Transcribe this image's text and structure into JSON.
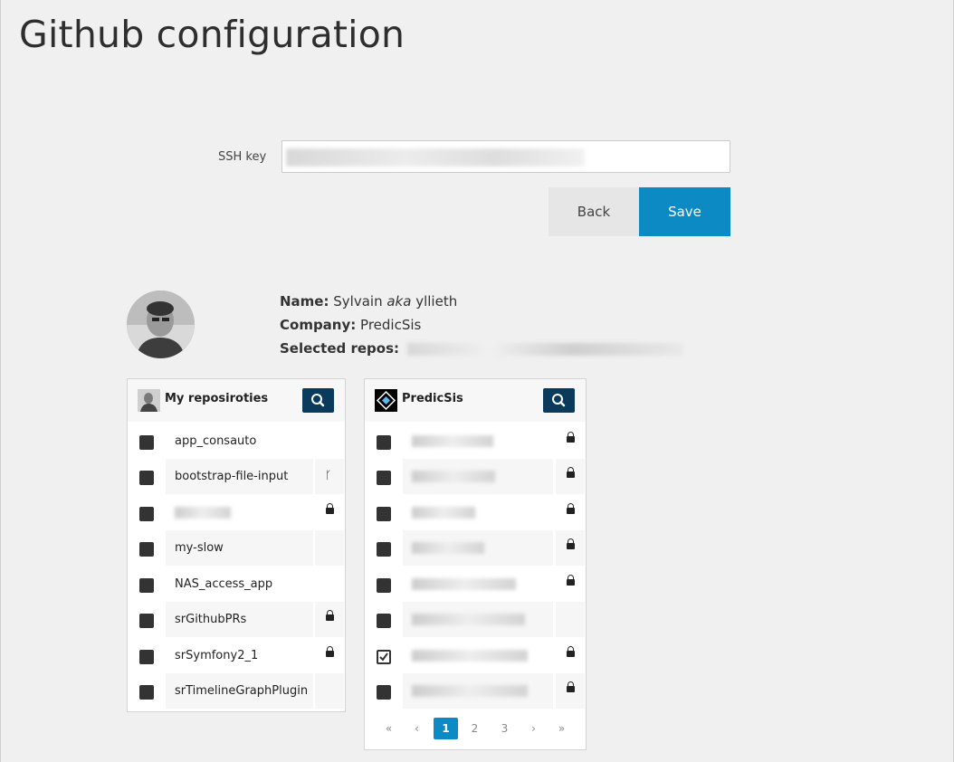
{
  "page": {
    "title": "Github configuration"
  },
  "form": {
    "ssh_label": "SSH key",
    "back_label": "Back",
    "save_label": "Save"
  },
  "profile": {
    "name_label": "Name:",
    "name_first": "Sylvain",
    "aka": "aka",
    "username": "yllieth",
    "company_label": "Company:",
    "company": "PredicSis",
    "repos_label": "Selected repos:"
  },
  "left_panel": {
    "title": "My reposiroties",
    "rows": [
      {
        "name": "app_consauto",
        "icon": ""
      },
      {
        "name": "bootstrap-file-input",
        "icon": "fork-icon"
      },
      {
        "name": "",
        "icon": "lock-icon"
      },
      {
        "name": "my-slow",
        "icon": ""
      },
      {
        "name": "NAS_access_app",
        "icon": ""
      },
      {
        "name": "srGithubPRs",
        "icon": "lock-icon"
      },
      {
        "name": "srSymfony2_1",
        "icon": "lock-icon"
      },
      {
        "name": "srTimelineGraphPlugin",
        "icon": ""
      }
    ]
  },
  "right_panel": {
    "title": "PredicSis",
    "rows": [
      {
        "checked": false,
        "icon": "lock-icon"
      },
      {
        "checked": false,
        "icon": "lock-icon"
      },
      {
        "checked": false,
        "icon": "lock-icon"
      },
      {
        "checked": false,
        "icon": "lock-icon"
      },
      {
        "checked": false,
        "icon": "lock-icon"
      },
      {
        "checked": false,
        "icon": ""
      },
      {
        "checked": true,
        "icon": "lock-icon"
      },
      {
        "checked": false,
        "icon": "lock-icon"
      }
    ],
    "pagination": {
      "first": "«",
      "prev": "‹",
      "pages": [
        "1",
        "2",
        "3"
      ],
      "active_page": "1",
      "next": "›",
      "last": "»"
    }
  },
  "colors": {
    "primary": "#0b8ac3",
    "search_button": "#0a3b5c"
  }
}
